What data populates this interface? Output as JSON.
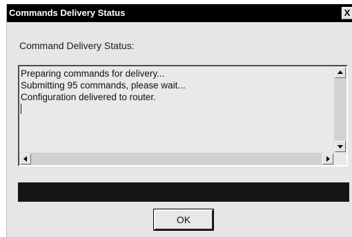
{
  "window": {
    "title": "Commands Delivery Status",
    "close_label": "X"
  },
  "status_label": "Command Delivery Status:",
  "log": {
    "lines": [
      "Preparing commands for delivery...",
      "Submitting 95 commands, please wait...",
      "Configuration delivered to router."
    ]
  },
  "progress": {
    "fraction": 1.0
  },
  "buttons": {
    "ok_label": "OK"
  },
  "colors": {
    "titlebar": "#000000",
    "progress_fill": "#151515",
    "window_bg": "#e6e6e6"
  }
}
